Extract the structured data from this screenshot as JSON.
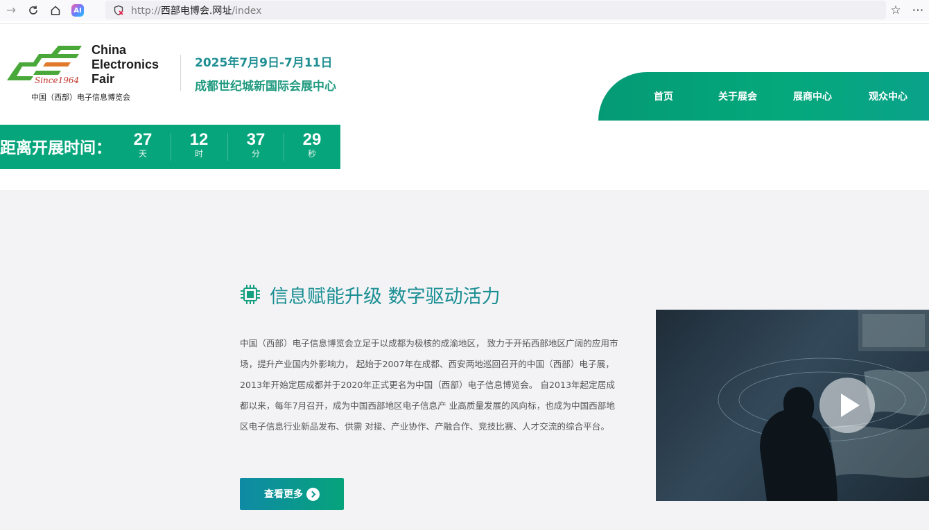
{
  "browser": {
    "url_prefix": "http://",
    "url_domain": "西部电博会.网址",
    "url_path": "/index",
    "icons": [
      "forward-icon",
      "reload-icon",
      "home-icon",
      "ai-icon",
      "shield-icon",
      "star-icon",
      "more-icon"
    ],
    "ai_label": "AI"
  },
  "logo": {
    "en_line1": "China",
    "en_line2": "Electronics",
    "en_line3": "Fair",
    "since": "Since1964",
    "cn": "中国（西部）电子信息博览会"
  },
  "header": {
    "date": "2025年7月9日-7月11日",
    "venue": "成都世纪城新国际会展中心"
  },
  "nav": {
    "items": [
      "首页",
      "关于展会",
      "展商中心",
      "观众中心"
    ]
  },
  "countdown": {
    "label": "距离开展时间：",
    "cells": [
      {
        "value": "27",
        "unit": "天"
      },
      {
        "value": "12",
        "unit": "时"
      },
      {
        "value": "37",
        "unit": "分"
      },
      {
        "value": "29",
        "unit": "秒"
      }
    ]
  },
  "intro": {
    "headline": "信息赋能升级 数字驱动活力",
    "paragraph": "中国（西部）电子信息博览会立足于以成都为极核的成渝地区， 致力于开拓西部地区广阔的应用市场，提升产业国内外影响力， 起始于2007年在成都、西安两地巡回召开的中国（西部）电子展， 2013年开始定居成都并于2020年正式更名为中国（西部）电子信息博览会。 自2013年起定居成都以来，每年7月召开，成为中国西部地区电子信息产 业高质量发展的风向标，也成为中国西部地区电子信息行业新品发布、供需 对接、产业协作、产融合作、竞技比赛、人才交流的综合平台。",
    "button": "查看更多"
  },
  "colors": {
    "brand_green": "#06a57b",
    "brand_teal": "#1a8f93",
    "section_bg": "#f3f3f6"
  }
}
